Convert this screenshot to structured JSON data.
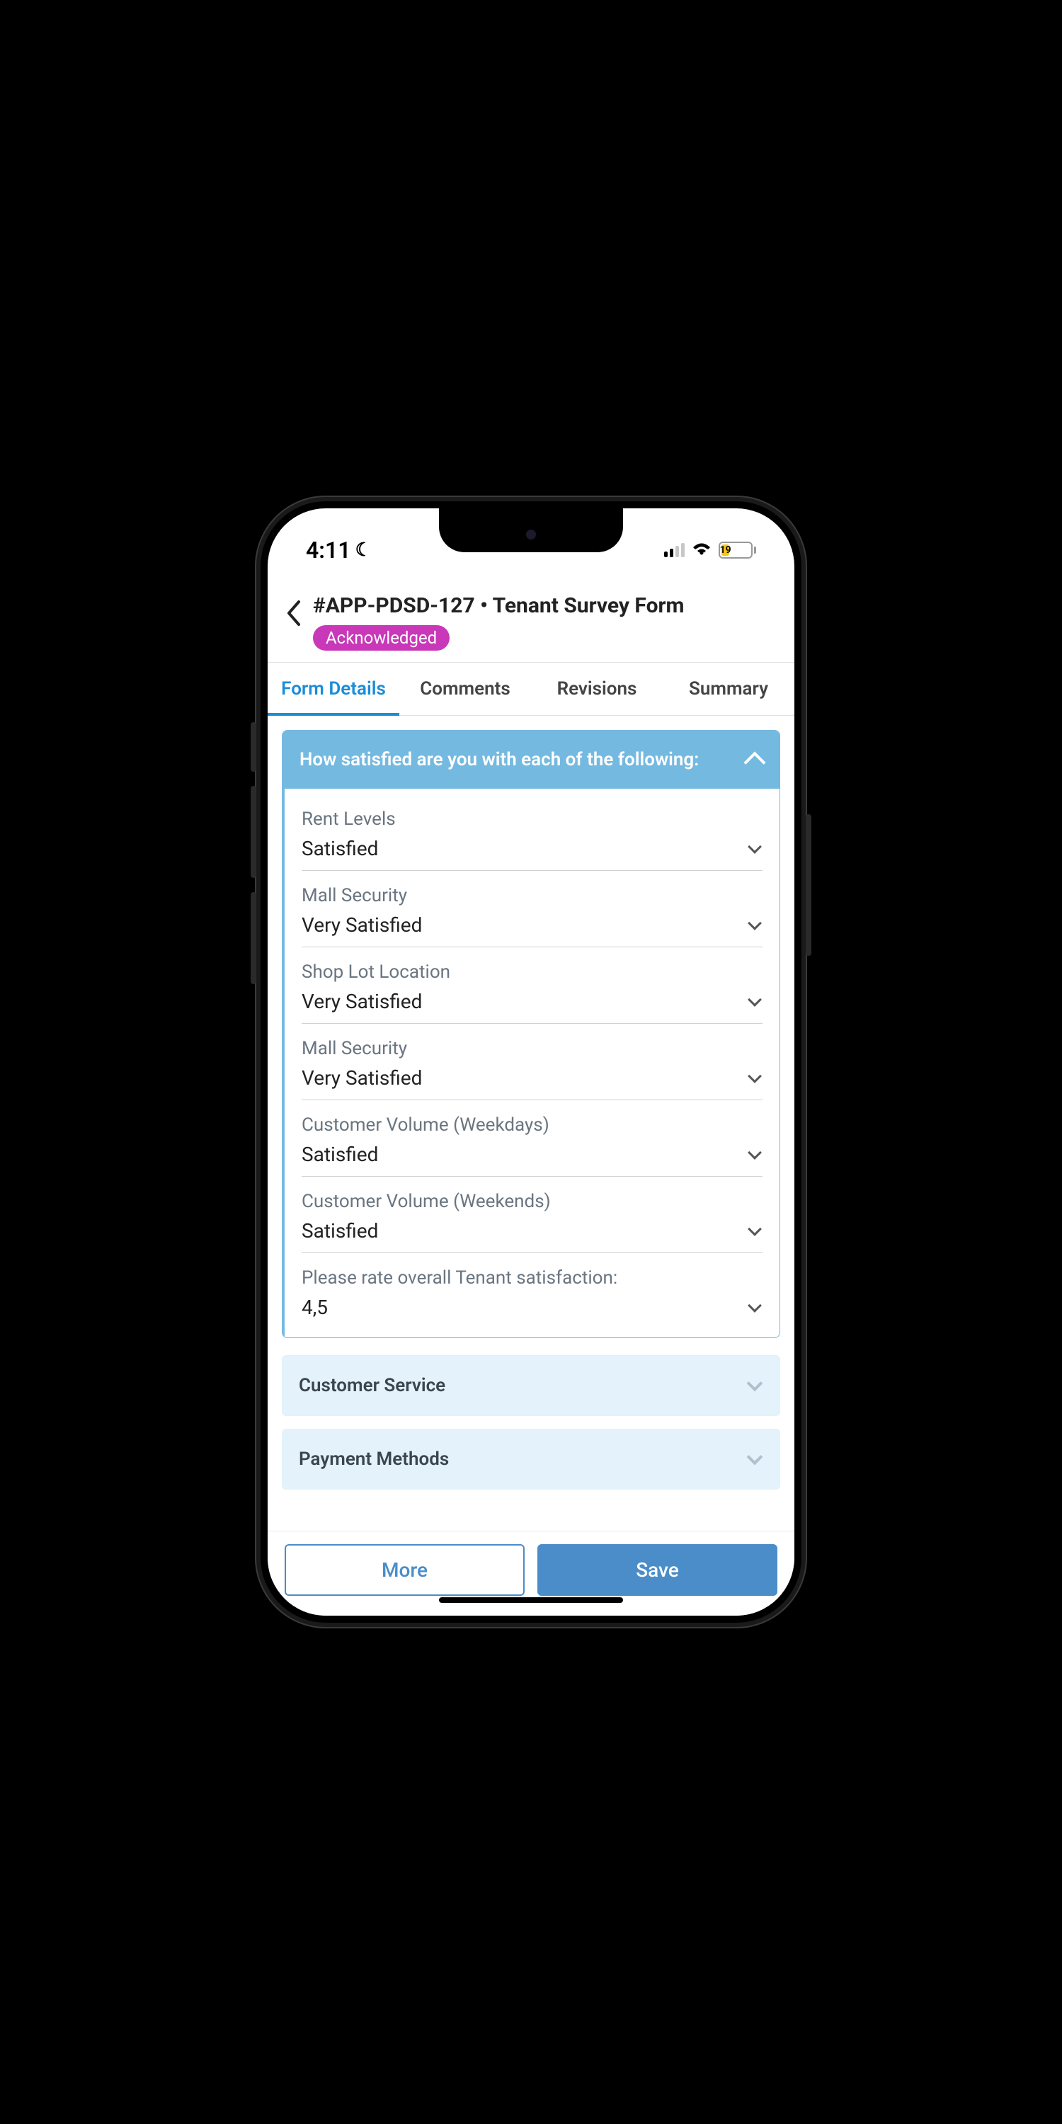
{
  "status_bar": {
    "time": "4:11",
    "battery_percent": "19",
    "battery_fill_width": "28%"
  },
  "header": {
    "title": "#APP-PDSD-127 • Tenant Survey Form",
    "badge": "Acknowledged"
  },
  "tabs": [
    {
      "label": "Form Details",
      "active": true
    },
    {
      "label": "Comments",
      "active": false
    },
    {
      "label": "Revisions",
      "active": false
    },
    {
      "label": "Summary",
      "active": false
    }
  ],
  "satisfaction_panel": {
    "title": "How satisfied are you with each of the following:",
    "fields": [
      {
        "label": "Rent Levels",
        "value": "Satisfied"
      },
      {
        "label": "Mall Security",
        "value": "Very Satisfied"
      },
      {
        "label": "Shop Lot Location",
        "value": "Very Satisfied"
      },
      {
        "label": "Mall Security",
        "value": "Very Satisfied"
      },
      {
        "label": "Customer Volume (Weekdays)",
        "value": "Satisfied"
      },
      {
        "label": "Customer Volume (Weekends)",
        "value": "Satisfied"
      },
      {
        "label": "Please rate overall Tenant satisfaction:",
        "value": "4,5"
      }
    ]
  },
  "collapsed_sections": [
    {
      "title": "Customer Service"
    },
    {
      "title": "Payment Methods"
    }
  ],
  "footer": {
    "more": "More",
    "save": "Save"
  }
}
